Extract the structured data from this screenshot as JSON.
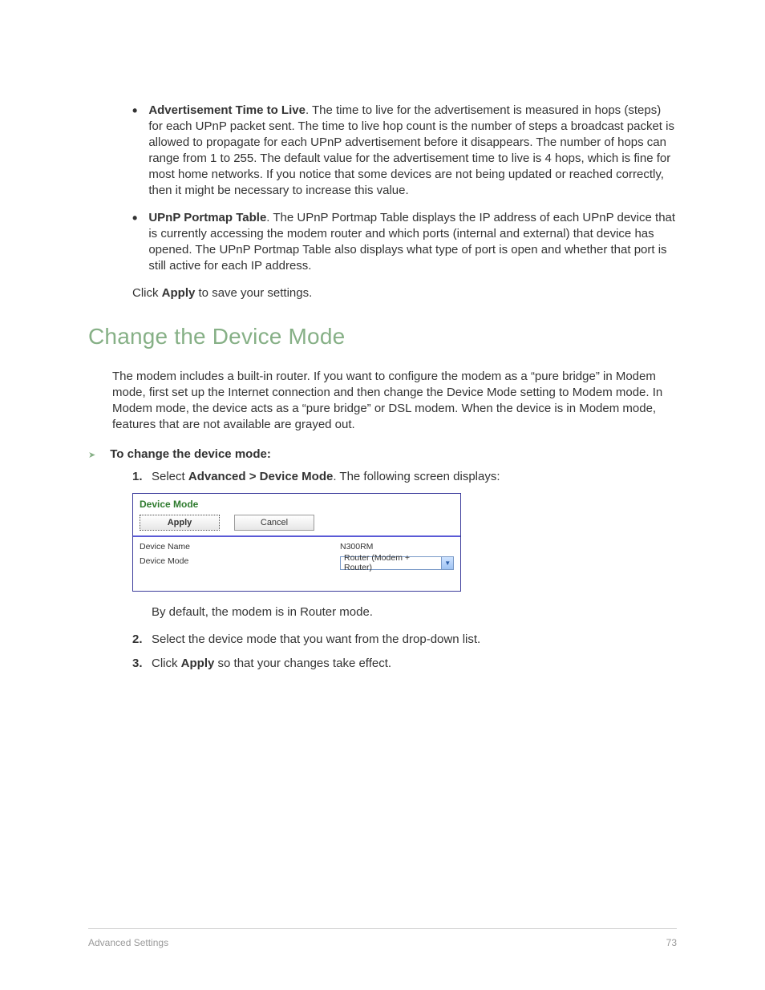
{
  "bullets": {
    "ttl": {
      "label": "Advertisement Time to Live",
      "text": ". The time to live for the advertisement is measured in hops (steps) for each UPnP packet sent. The time to live hop count is the number of steps a broadcast packet is allowed to propagate for each UPnP advertisement before it disappears. The number of hops can range from 1 to 255. The default value for the advertisement time to live is 4 hops, which is fine for most home networks. If you notice that some devices are not being updated or reached correctly, then it might be necessary to increase this value."
    },
    "portmap": {
      "label": "UPnP Portmap Table",
      "text": ". The UPnP Portmap Table displays the IP address of each UPnP device that is currently accessing the modem router and which ports (internal and external) that device has opened. The UPnP Portmap Table also displays what type of port is open and whether that port is still active for each IP address."
    }
  },
  "click_apply": {
    "pre": "Click ",
    "bold": "Apply",
    "post": " to save your settings."
  },
  "heading": "Change the Device Mode",
  "intro": "The modem includes a built-in router. If you want to configure the modem as a “pure bridge” in Modem mode, first set up the Internet connection and then change the Device Mode setting to Modem mode. In Modem mode, the device acts as a “pure bridge” or DSL modem. When the device is in Modem mode, features that are not available are grayed out.",
  "procedure_title": "To change the device mode:",
  "step1": {
    "num": "1.",
    "pre": "Select ",
    "bold": "Advanced > Device Mode",
    "post": ". The following screen displays:"
  },
  "panel": {
    "title": "Device Mode",
    "apply": "Apply",
    "cancel": "Cancel",
    "device_name_label": "Device Name",
    "device_name_value": "N300RM",
    "device_mode_label": "Device Mode",
    "device_mode_value": "Router (Modem + Router)"
  },
  "after_default": "By default, the modem is in Router mode.",
  "step2": {
    "num": "2.",
    "text": "Select the device mode that you want from the drop-down list."
  },
  "step3": {
    "num": "3.",
    "pre": "Click ",
    "bold": "Apply",
    "post": " so that your changes take effect."
  },
  "footer": {
    "left": "Advanced Settings",
    "right": "73"
  }
}
